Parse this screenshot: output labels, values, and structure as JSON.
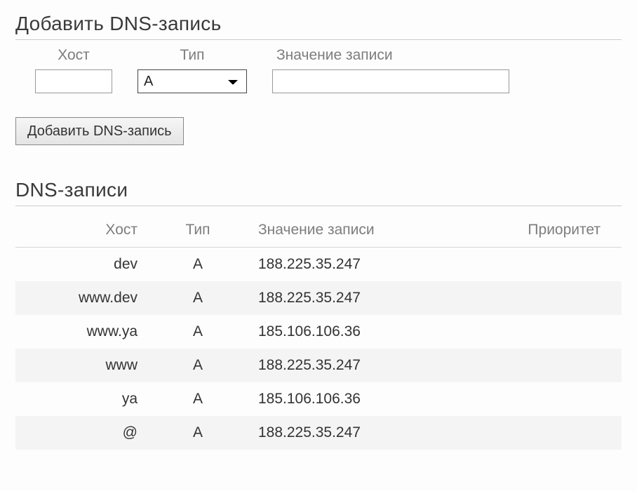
{
  "add_form": {
    "heading": "Добавить DNS-запись",
    "host_label": "Хост",
    "type_label": "Тип",
    "value_label": "Значение записи",
    "host_value": "",
    "type_value": "A",
    "record_value": "",
    "submit_label": "Добавить DNS-запись"
  },
  "records": {
    "heading": "DNS-записи",
    "columns": {
      "host": "Хост",
      "type": "Тип",
      "value": "Значение записи",
      "priority": "Приоритет"
    },
    "rows": [
      {
        "host": "dev",
        "type": "A",
        "value": "188.225.35.247",
        "priority": ""
      },
      {
        "host": "www.dev",
        "type": "A",
        "value": "188.225.35.247",
        "priority": ""
      },
      {
        "host": "www.ya",
        "type": "A",
        "value": "185.106.106.36",
        "priority": ""
      },
      {
        "host": "www",
        "type": "A",
        "value": "188.225.35.247",
        "priority": ""
      },
      {
        "host": "ya",
        "type": "A",
        "value": "185.106.106.36",
        "priority": ""
      },
      {
        "host": "@",
        "type": "A",
        "value": "188.225.35.247",
        "priority": ""
      }
    ]
  }
}
